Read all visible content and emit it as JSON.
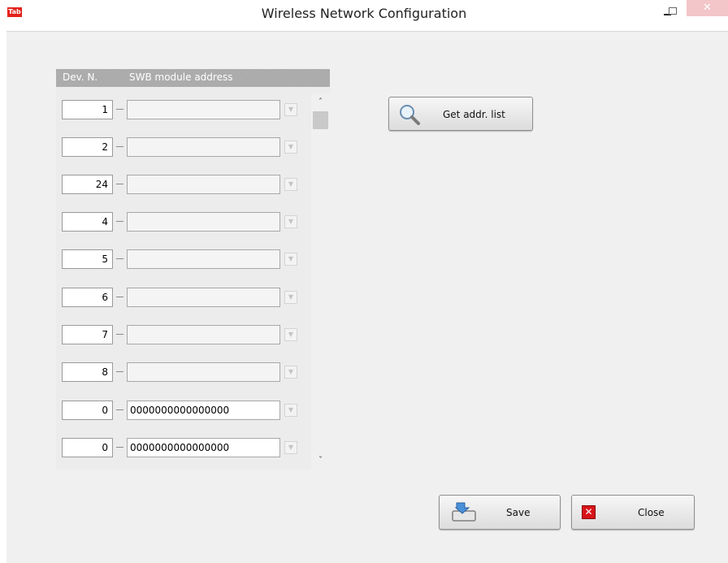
{
  "window": {
    "app_icon_label": "Tab",
    "title": "Wireless Network Configuration",
    "minimize": "–",
    "close": "✕"
  },
  "table": {
    "header_dev": "Dev. N.",
    "header_addr": "SWB module address",
    "rows": [
      {
        "dev": "1",
        "addr": ""
      },
      {
        "dev": "2",
        "addr": ""
      },
      {
        "dev": "24",
        "addr": ""
      },
      {
        "dev": "4",
        "addr": ""
      },
      {
        "dev": "5",
        "addr": ""
      },
      {
        "dev": "6",
        "addr": ""
      },
      {
        "dev": "7",
        "addr": ""
      },
      {
        "dev": "8",
        "addr": ""
      },
      {
        "dev": "0",
        "addr": "0000000000000000"
      },
      {
        "dev": "0",
        "addr": "0000000000000000"
      }
    ]
  },
  "scrollbar": {
    "up": "˄",
    "down": "˅"
  },
  "buttons": {
    "get_addr_list": "Get addr. list",
    "save": "Save",
    "close": "Close"
  },
  "icons": {
    "search": "magnifier-icon",
    "save": "save-icon",
    "close": "close-x-icon"
  },
  "colors": {
    "close_icon": "#d7141a",
    "header_bg": "#ababab",
    "app_icon": "#e2231a"
  }
}
